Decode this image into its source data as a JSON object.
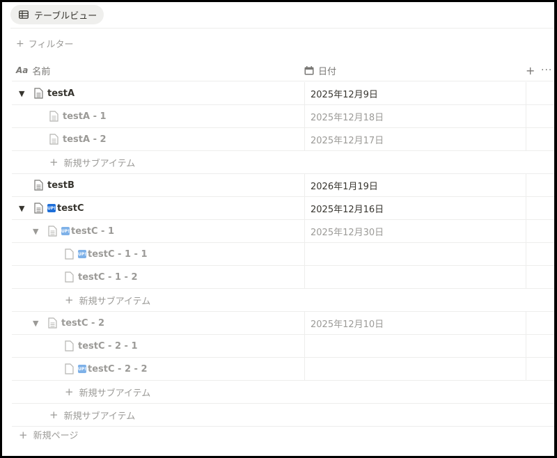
{
  "view": {
    "tab_label": "テーブルビュー"
  },
  "filter": {
    "label": "フィルター"
  },
  "header": {
    "name_label": "名前",
    "name_icon_text": "Aa",
    "date_label": "日付",
    "add": "+",
    "more": "···"
  },
  "rows": [
    {
      "name": "testA",
      "date": "2025年12月9日"
    },
    {
      "name": "testA - 1",
      "date": "2025年12月18日"
    },
    {
      "name": "testA - 2",
      "date": "2025年12月17日"
    },
    {
      "name": "testB",
      "date": "2026年1月19日"
    },
    {
      "name": "testC",
      "date": "2025年12月16日"
    },
    {
      "name": "testC - 1",
      "date": "2025年12月30日"
    },
    {
      "name": "testC - 1 - 1",
      "date": ""
    },
    {
      "name": "testC - 1 - 2",
      "date": ""
    },
    {
      "name": "testC - 2",
      "date": "2025年12月10日"
    },
    {
      "name": "testC - 2 - 1",
      "date": ""
    },
    {
      "name": "testC - 2 - 2",
      "date": ""
    }
  ],
  "new_sub_item": "新規サブアイテム",
  "new_page": "新規ページ",
  "badge_text": "UP!",
  "icons": {
    "expand": "triangle-down-icon",
    "page": "document-icon",
    "date": "calendar-icon",
    "table": "table-icon"
  },
  "colors": {
    "text": "#37352f",
    "muted": "#9b9a97",
    "badge": "#1e6fd9"
  }
}
